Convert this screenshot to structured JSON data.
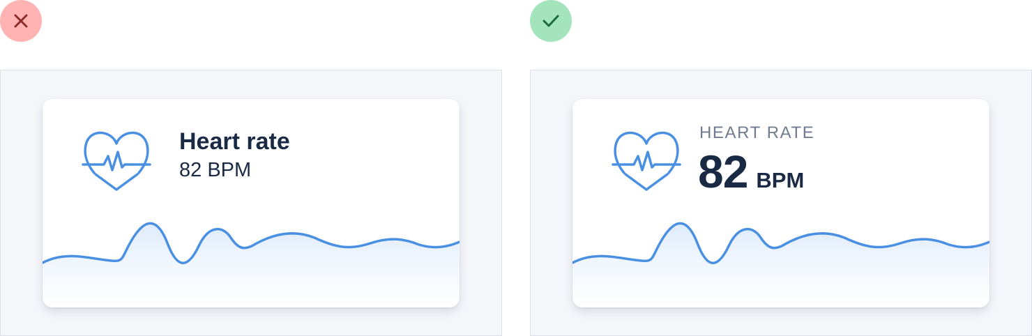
{
  "examples": {
    "bad": {
      "title": "Heart rate",
      "value": "82 BPM"
    },
    "good": {
      "label": "HEART RATE",
      "value_number": "82",
      "value_unit": "BPM"
    }
  },
  "icons": {
    "bad_badge": "close-icon",
    "good_badge": "check-icon",
    "metric": "heart-pulse-icon"
  },
  "colors": {
    "bad_badge_bg": "#ffb3b3",
    "bad_badge_icon": "#8e2a2a",
    "good_badge_bg": "#a3e4bd",
    "good_badge_icon": "#1d6b3c",
    "accent": "#4a90e2",
    "text_primary": "#1b2a44",
    "text_secondary": "#6f7c8f"
  }
}
